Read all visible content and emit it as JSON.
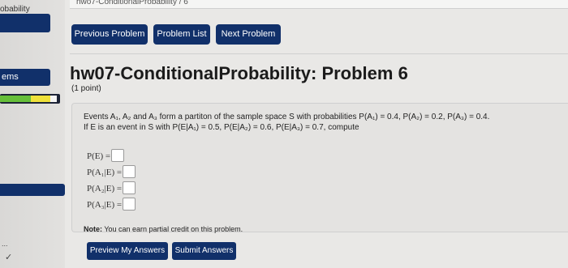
{
  "window": {
    "breadcrumb": "hwo7-ConditionalProbability / 6",
    "sidebar_title": "obability"
  },
  "sidebar": {
    "problems_label": "ems",
    "dots": "...",
    "check": "✓"
  },
  "nav": {
    "previous": "Previous Problem",
    "list": "Problem List",
    "next": "Next Problem"
  },
  "problem": {
    "title": "hw07-ConditionalProbability: Problem 6",
    "points": "(1 point)",
    "line1": "Events A₁, A₂ and A₃ form a partiton of the sample space S with probabilities P(A₁) = 0.4, P(A₂) = 0.2, P(A₃) = 0.4.",
    "line2": "If E is an event in S with P(E|A₁) = 0.5, P(E|A₂) = 0.6, P(E|A₃) = 0.7, compute",
    "answers": [
      {
        "label": "P(E) =",
        "value": ""
      },
      {
        "label": "P(A₁|E) =",
        "value": ""
      },
      {
        "label": "P(A₂|E) =",
        "value": ""
      },
      {
        "label": "P(A₃|E) =",
        "value": ""
      }
    ],
    "note_bold": "Note:",
    "note_text": " You can earn partial credit on this problem."
  },
  "submit": {
    "preview": "Preview My Answers",
    "submit": "Submit Answers"
  },
  "colors": {
    "accent": "#11306a",
    "progress_green": "#66bf3a",
    "progress_yellow": "#efe13a"
  }
}
